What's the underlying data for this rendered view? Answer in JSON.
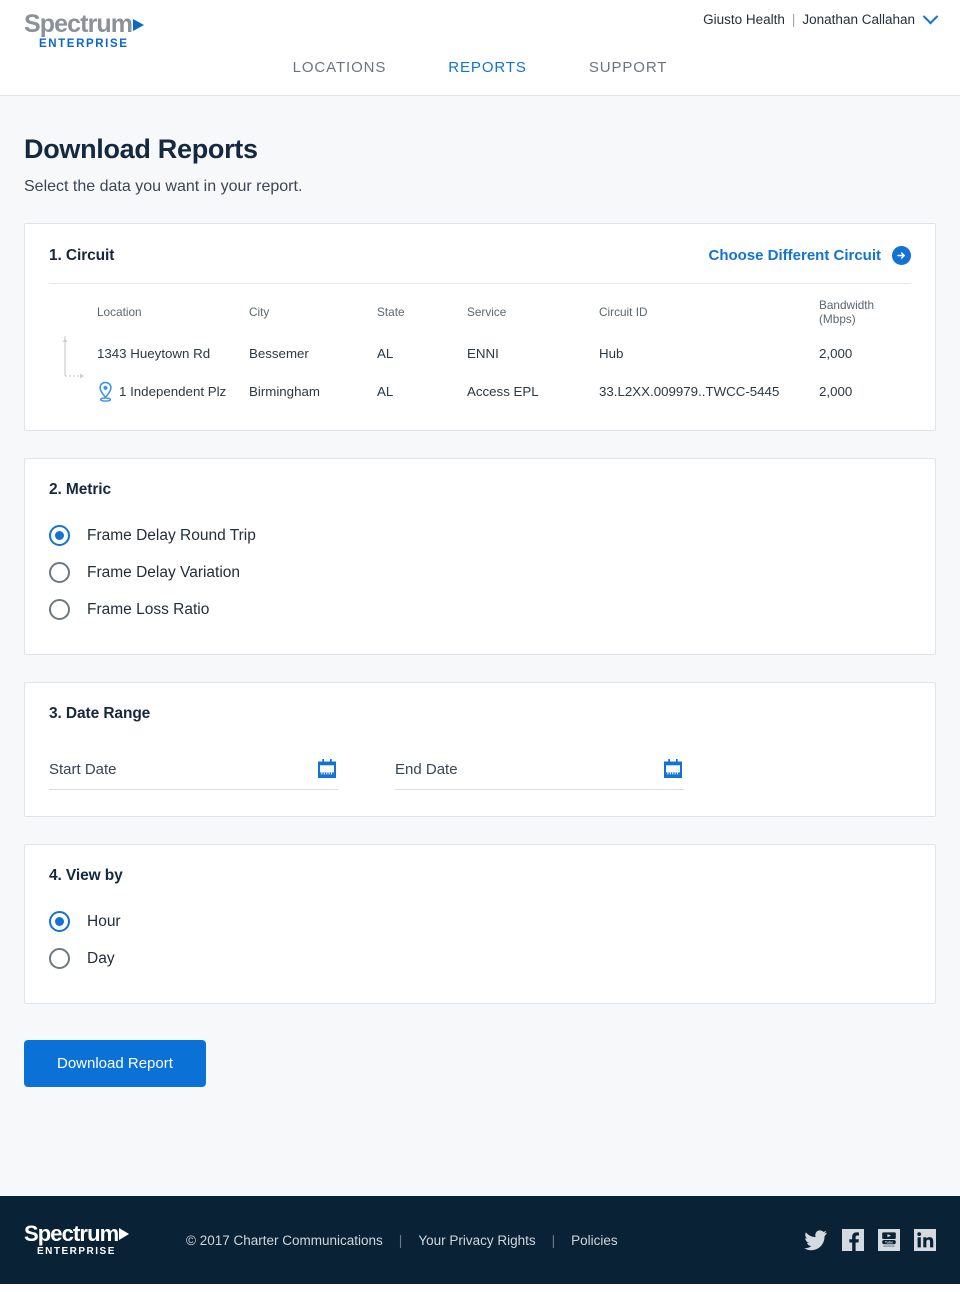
{
  "brand": {
    "logo_word": "Spectrum",
    "logo_sub": "ENTERPRISE"
  },
  "header": {
    "account_org": "Giusto Health",
    "account_separator": "|",
    "account_user": "Jonathan Callahan",
    "chevron_icon": "chevron-down-icon",
    "nav": [
      {
        "label": "LOCATIONS",
        "active": false
      },
      {
        "label": "REPORTS",
        "active": true
      },
      {
        "label": "SUPPORT",
        "active": false
      }
    ]
  },
  "page": {
    "title": "Download Reports",
    "subtitle": "Select the data you want in your report."
  },
  "circuit": {
    "step_title": "1. Circuit",
    "choose_link": "Choose Different Circuit",
    "choose_icon": "arrow-right-circle-icon",
    "columns": [
      "Location",
      "City",
      "State",
      "Service",
      "Circuit ID",
      "Bandwidth (Mbps)"
    ],
    "rows": [
      {
        "location": "1343 Hueytown Rd",
        "city": "Bessemer",
        "state": "AL",
        "service": "ENNI",
        "circuit_id": "Hub",
        "bandwidth": "2,000",
        "has_pin": false
      },
      {
        "location": "1 Independent Plz",
        "city": "Birmingham",
        "state": "AL",
        "service": "Access EPL",
        "circuit_id": "33.L2XX.009979..TWCC-5445",
        "bandwidth": "2,000",
        "has_pin": true
      }
    ]
  },
  "metric": {
    "step_title": "2. Metric",
    "options": [
      {
        "label": "Frame Delay Round Trip",
        "selected": true
      },
      {
        "label": "Frame Delay Variation",
        "selected": false
      },
      {
        "label": "Frame Loss Ratio",
        "selected": false
      }
    ]
  },
  "date_range": {
    "step_title": "3. Date Range",
    "start": {
      "value": "",
      "placeholder": "Start Date",
      "icon": "calendar-icon"
    },
    "end": {
      "value": "",
      "placeholder": "End Date",
      "icon": "calendar-icon"
    }
  },
  "view_by": {
    "step_title": "4. View by",
    "options": [
      {
        "label": "Hour",
        "selected": true
      },
      {
        "label": "Day",
        "selected": false
      }
    ]
  },
  "actions": {
    "download_label": "Download Report"
  },
  "footer": {
    "copyright": "© 2017 Charter Communications",
    "sep1": "|",
    "privacy": "Your Privacy Rights",
    "sep2": "|",
    "policies": "Policies",
    "socials": [
      "twitter-icon",
      "facebook-icon",
      "youtube-icon",
      "linkedin-icon"
    ]
  },
  "colors": {
    "accent_blue": "#1273d4",
    "button_blue": "#0a72d6",
    "dark_navy": "#0a2236",
    "page_bg": "#f7f8f9",
    "title_navy": "#14293f"
  }
}
